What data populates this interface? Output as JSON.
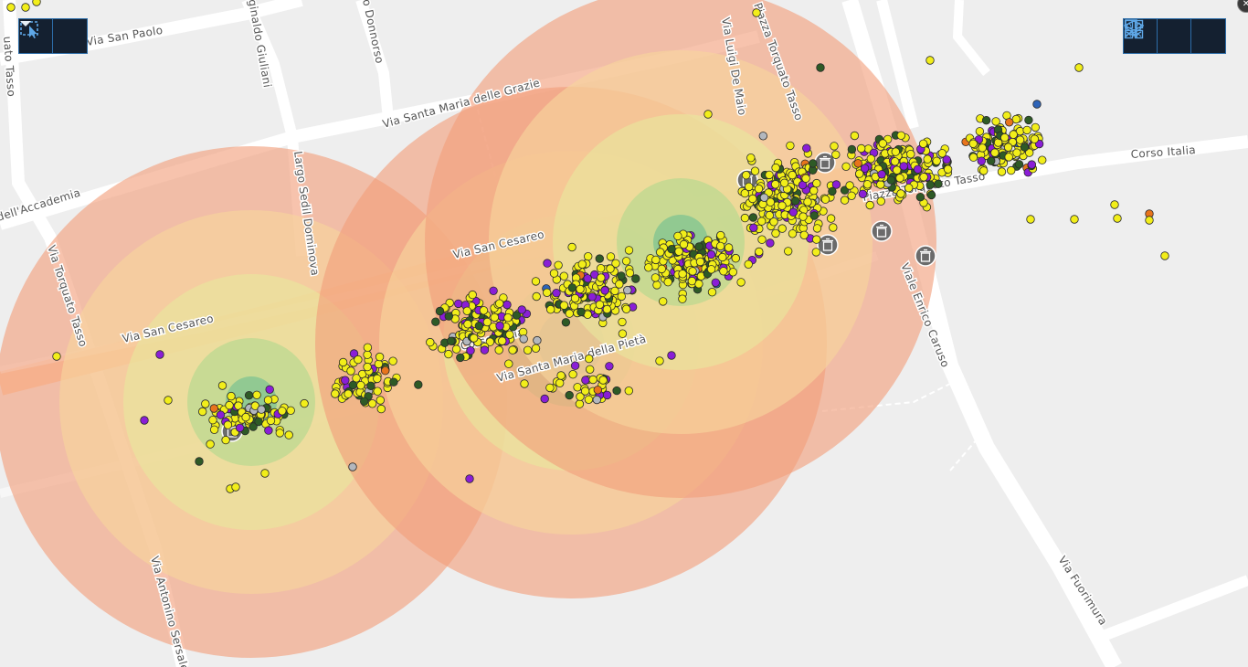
{
  "map": {
    "streets": [
      {
        "name": "Via San Paolo"
      },
      {
        "name": "Via Santa Maria delle Grazie"
      },
      {
        "name": "Corso Italia"
      },
      {
        "name": "Via San Cesareo"
      },
      {
        "name": "Via San Cesareo"
      },
      {
        "name": "Corso Italia"
      },
      {
        "name": "Via Santa Maria della Pietà"
      },
      {
        "name": "Piazza Torquato Tasso"
      },
      {
        "name": "Piazza Torquato Tasso"
      },
      {
        "name": "Via Luigi De Maio"
      },
      {
        "name": "Viale Enrico Caruso"
      },
      {
        "name": "Via Fuorimura"
      },
      {
        "name": "Via Antonino Sersale"
      },
      {
        "name": "Largo Sedil Dominova"
      },
      {
        "name": "Via Torquato Tasso"
      },
      {
        "name": "dell'Accademia"
      },
      {
        "name": "ginaldo Giuliani"
      },
      {
        "name": "o Donnorso"
      },
      {
        "name": "uato Tasso"
      }
    ],
    "point_colors": {
      "yellow": "#f2ee1a",
      "dark_green": "#2e5a26",
      "purple": "#8a1ed6",
      "gray": "#b3b7bd",
      "orange": "#e8741c",
      "blue": "#2e64b8"
    },
    "buffer_ring_colors": [
      "#f29e7a",
      "#f7d59c",
      "#e9e79d",
      "#b2d88e",
      "#6fbf92"
    ],
    "buffer_opacity": 0.62,
    "marker_icon": "trash-icon"
  },
  "toolbar_left": {
    "buttons": [
      {
        "icon": "select-features-icon"
      },
      {
        "icon": "chevron-down-icon"
      }
    ]
  },
  "toolbar_right": {
    "buttons": [
      {
        "icon": "bookmark-icon"
      },
      {
        "icon": "layers-icon"
      },
      {
        "icon": "basemap-gallery-icon"
      }
    ]
  },
  "close_icon": "close-icon"
}
